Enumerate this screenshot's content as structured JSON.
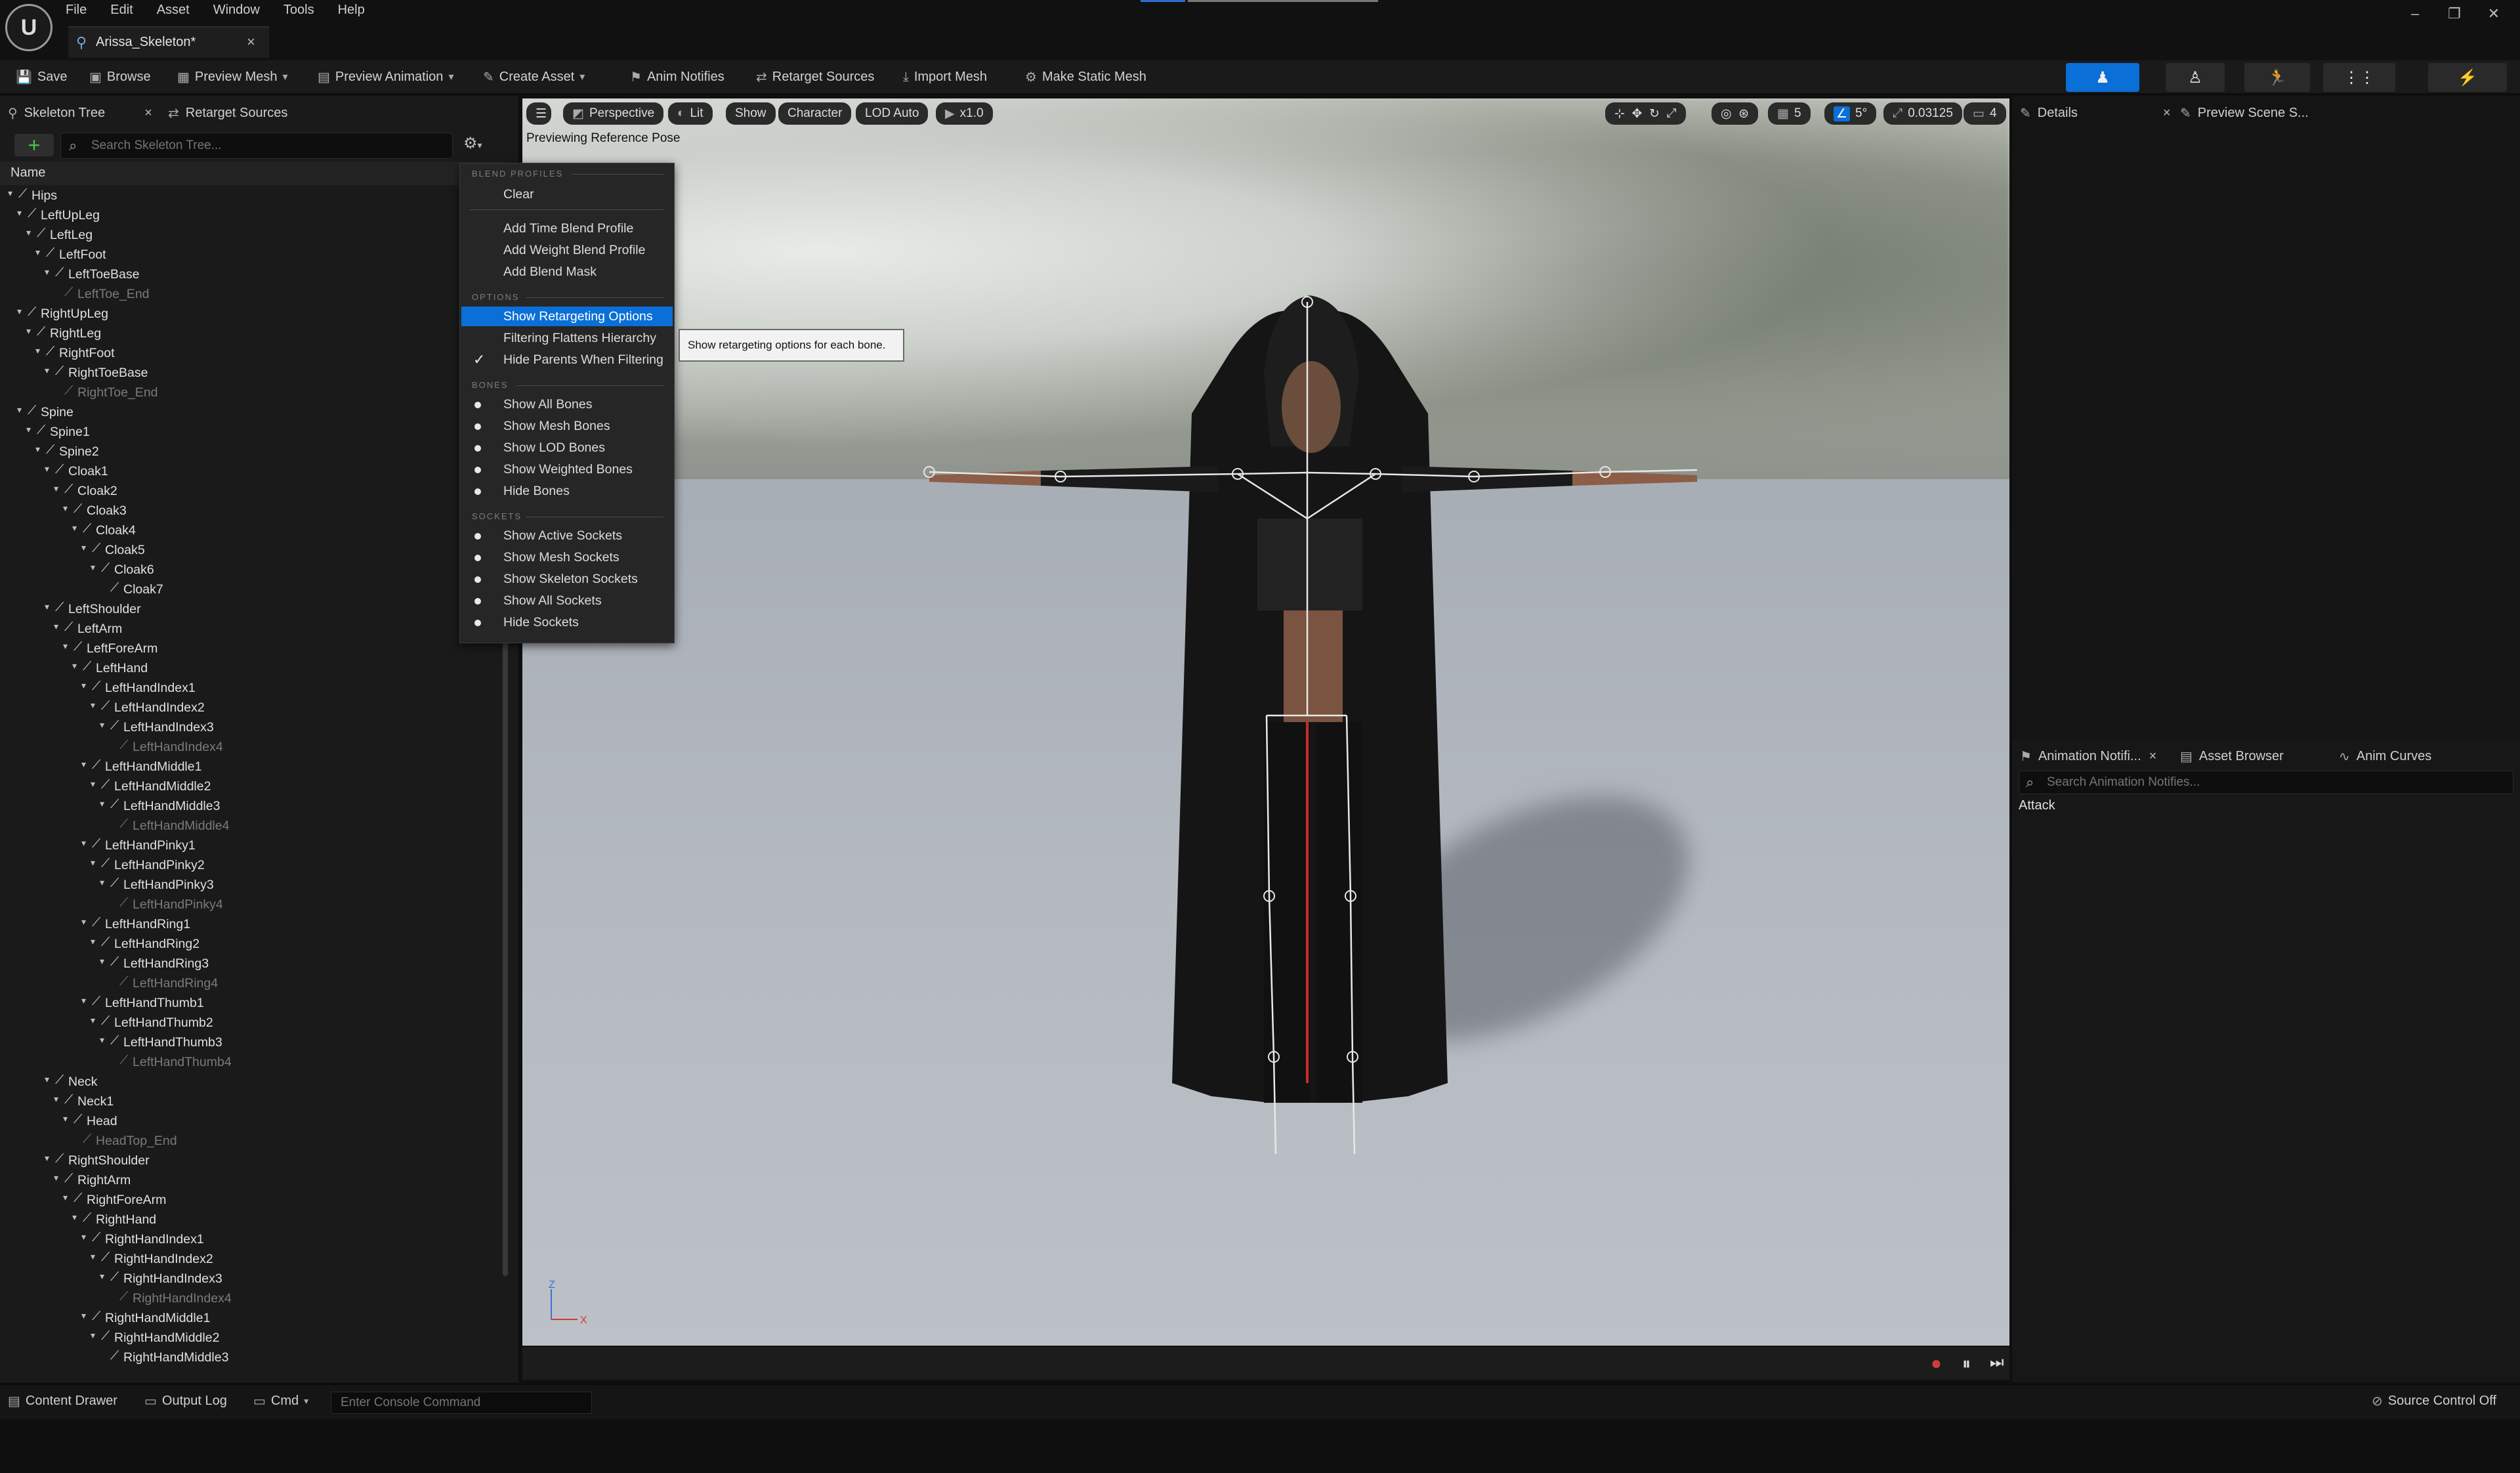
{
  "menubar": [
    "File",
    "Edit",
    "Asset",
    "Window",
    "Tools",
    "Help"
  ],
  "document_tab": "Arissa_Skeleton*",
  "toolbar": {
    "save": "Save",
    "browse": "Browse",
    "preview_mesh": "Preview Mesh",
    "preview_animation": "Preview Animation",
    "create_asset": "Create Asset",
    "anim_notifies": "Anim Notifies",
    "retarget_sources": "Retarget Sources",
    "import_mesh": "Import Mesh",
    "make_static_mesh": "Make Static Mesh"
  },
  "left_panel": {
    "tab_skeleton_tree": "Skeleton Tree",
    "tab_retarget_sources": "Retarget Sources",
    "search_placeholder": "Search Skeleton Tree...",
    "column_name": "Name"
  },
  "bones": [
    {
      "name": "Hips",
      "depth": 0,
      "dim": false
    },
    {
      "name": "LeftUpLeg",
      "depth": 1,
      "dim": false
    },
    {
      "name": "LeftLeg",
      "depth": 2,
      "dim": false
    },
    {
      "name": "LeftFoot",
      "depth": 3,
      "dim": false
    },
    {
      "name": "LeftToeBase",
      "depth": 4,
      "dim": false
    },
    {
      "name": "LeftToe_End",
      "depth": 5,
      "dim": true
    },
    {
      "name": "RightUpLeg",
      "depth": 1,
      "dim": false
    },
    {
      "name": "RightLeg",
      "depth": 2,
      "dim": false
    },
    {
      "name": "RightFoot",
      "depth": 3,
      "dim": false
    },
    {
      "name": "RightToeBase",
      "depth": 4,
      "dim": false
    },
    {
      "name": "RightToe_End",
      "depth": 5,
      "dim": true
    },
    {
      "name": "Spine",
      "depth": 1,
      "dim": false
    },
    {
      "name": "Spine1",
      "depth": 2,
      "dim": false
    },
    {
      "name": "Spine2",
      "depth": 3,
      "dim": false
    },
    {
      "name": "Cloak1",
      "depth": 4,
      "dim": false
    },
    {
      "name": "Cloak2",
      "depth": 5,
      "dim": false
    },
    {
      "name": "Cloak3",
      "depth": 6,
      "dim": false
    },
    {
      "name": "Cloak4",
      "depth": 7,
      "dim": false
    },
    {
      "name": "Cloak5",
      "depth": 8,
      "dim": false
    },
    {
      "name": "Cloak6",
      "depth": 9,
      "dim": false
    },
    {
      "name": "Cloak7",
      "depth": 10,
      "dim": false
    },
    {
      "name": "LeftShoulder",
      "depth": 4,
      "dim": false
    },
    {
      "name": "LeftArm",
      "depth": 5,
      "dim": false
    },
    {
      "name": "LeftForeArm",
      "depth": 6,
      "dim": false
    },
    {
      "name": "LeftHand",
      "depth": 7,
      "dim": false
    },
    {
      "name": "LeftHandIndex1",
      "depth": 8,
      "dim": false
    },
    {
      "name": "LeftHandIndex2",
      "depth": 9,
      "dim": false
    },
    {
      "name": "LeftHandIndex3",
      "depth": 10,
      "dim": false
    },
    {
      "name": "LeftHandIndex4",
      "depth": 11,
      "dim": true
    },
    {
      "name": "LeftHandMiddle1",
      "depth": 8,
      "dim": false
    },
    {
      "name": "LeftHandMiddle2",
      "depth": 9,
      "dim": false
    },
    {
      "name": "LeftHandMiddle3",
      "depth": 10,
      "dim": false
    },
    {
      "name": "LeftHandMiddle4",
      "depth": 11,
      "dim": true
    },
    {
      "name": "LeftHandPinky1",
      "depth": 8,
      "dim": false
    },
    {
      "name": "LeftHandPinky2",
      "depth": 9,
      "dim": false
    },
    {
      "name": "LeftHandPinky3",
      "depth": 10,
      "dim": false
    },
    {
      "name": "LeftHandPinky4",
      "depth": 11,
      "dim": true
    },
    {
      "name": "LeftHandRing1",
      "depth": 8,
      "dim": false
    },
    {
      "name": "LeftHandRing2",
      "depth": 9,
      "dim": false
    },
    {
      "name": "LeftHandRing3",
      "depth": 10,
      "dim": false
    },
    {
      "name": "LeftHandRing4",
      "depth": 11,
      "dim": true
    },
    {
      "name": "LeftHandThumb1",
      "depth": 8,
      "dim": false
    },
    {
      "name": "LeftHandThumb2",
      "depth": 9,
      "dim": false
    },
    {
      "name": "LeftHandThumb3",
      "depth": 10,
      "dim": false
    },
    {
      "name": "LeftHandThumb4",
      "depth": 11,
      "dim": true
    },
    {
      "name": "Neck",
      "depth": 4,
      "dim": false
    },
    {
      "name": "Neck1",
      "depth": 5,
      "dim": false
    },
    {
      "name": "Head",
      "depth": 6,
      "dim": false
    },
    {
      "name": "HeadTop_End",
      "depth": 7,
      "dim": true
    },
    {
      "name": "RightShoulder",
      "depth": 4,
      "dim": false
    },
    {
      "name": "RightArm",
      "depth": 5,
      "dim": false
    },
    {
      "name": "RightForeArm",
      "depth": 6,
      "dim": false
    },
    {
      "name": "RightHand",
      "depth": 7,
      "dim": false
    },
    {
      "name": "RightHandIndex1",
      "depth": 8,
      "dim": false
    },
    {
      "name": "RightHandIndex2",
      "depth": 9,
      "dim": false
    },
    {
      "name": "RightHandIndex3",
      "depth": 10,
      "dim": false
    },
    {
      "name": "RightHandIndex4",
      "depth": 11,
      "dim": true
    },
    {
      "name": "RightHandMiddle1",
      "depth": 8,
      "dim": false
    },
    {
      "name": "RightHandMiddle2",
      "depth": 9,
      "dim": false
    },
    {
      "name": "RightHandMiddle3",
      "depth": 10,
      "dim": false
    }
  ],
  "menu": {
    "header_blend_profiles": "BLEND PROFILES",
    "clear": "Clear",
    "add_time_blend_profile": "Add Time Blend Profile",
    "add_weight_blend_profile": "Add Weight Blend Profile",
    "add_blend_mask": "Add Blend Mask",
    "header_options": "OPTIONS",
    "show_retargeting_options": "Show Retargeting Options",
    "filtering_flattens_hierarchy": "Filtering Flattens Hierarchy",
    "hide_parents_when_filtering": "Hide Parents When Filtering",
    "header_bones": "BONES",
    "show_all_bones": "Show All Bones",
    "show_mesh_bones": "Show Mesh Bones",
    "show_lod_bones": "Show LOD Bones",
    "show_weighted_bones": "Show Weighted Bones",
    "hide_bones": "Hide Bones",
    "header_sockets": "SOCKETS",
    "show_active_sockets": "Show Active Sockets",
    "show_mesh_sockets": "Show Mesh Sockets",
    "show_skeleton_sockets": "Show Skeleton Sockets",
    "show_all_sockets": "Show All Sockets",
    "hide_sockets": "Hide Sockets"
  },
  "tooltip": "Show retargeting options for each bone.",
  "viewport": {
    "perspective": "Perspective",
    "lit": "Lit",
    "show": "Show",
    "character": "Character",
    "lod": "LOD Auto",
    "speed": "x1.0",
    "overlay_text": "Previewing Reference Pose",
    "grid_value": "5",
    "angle_value": "5°",
    "scale_value": "0.03125",
    "camera_value": "4",
    "axis_z": "Z",
    "axis_x": "X"
  },
  "right_panel": {
    "details_tab": "Details",
    "preview_scene_tab": "Preview Scene S...",
    "anim_notifies_tab": "Animation Notifi...",
    "asset_browser_tab": "Asset Browser",
    "anim_curves_tab": "Anim Curves",
    "notify_search_placeholder": "Search Animation Notifies...",
    "notify_item": "Attack"
  },
  "statusbar": {
    "content_drawer": "Content Drawer",
    "output_log": "Output Log",
    "cmd": "Cmd",
    "console_placeholder": "Enter Console Command",
    "source_control": "Source Control Off"
  },
  "colors": {
    "accent": "#0a6fd6",
    "add_green": "#4bc04b",
    "bone_line": "#e8e8e8",
    "selected_bone": "#cc2a2a"
  }
}
